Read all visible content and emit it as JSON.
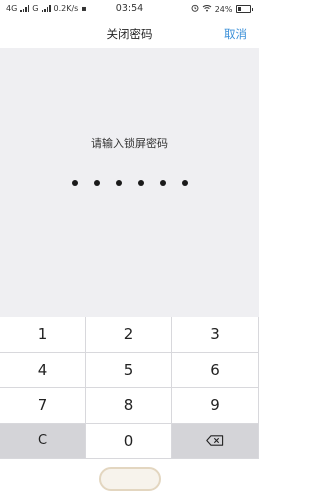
{
  "status_bar": {
    "carrier1": "4G",
    "carrier2": "G",
    "net_speed": "0.2K/s",
    "time": "03:54",
    "battery": "24%"
  },
  "nav": {
    "title": "关闭密码",
    "cancel": "取消"
  },
  "content": {
    "prompt": "请输入锁屏密码",
    "entered_digits": 6
  },
  "keypad": {
    "keys": [
      "1",
      "2",
      "3",
      "4",
      "5",
      "6",
      "7",
      "8",
      "9",
      "C",
      "0"
    ],
    "backspace_icon": "backspace-icon"
  }
}
